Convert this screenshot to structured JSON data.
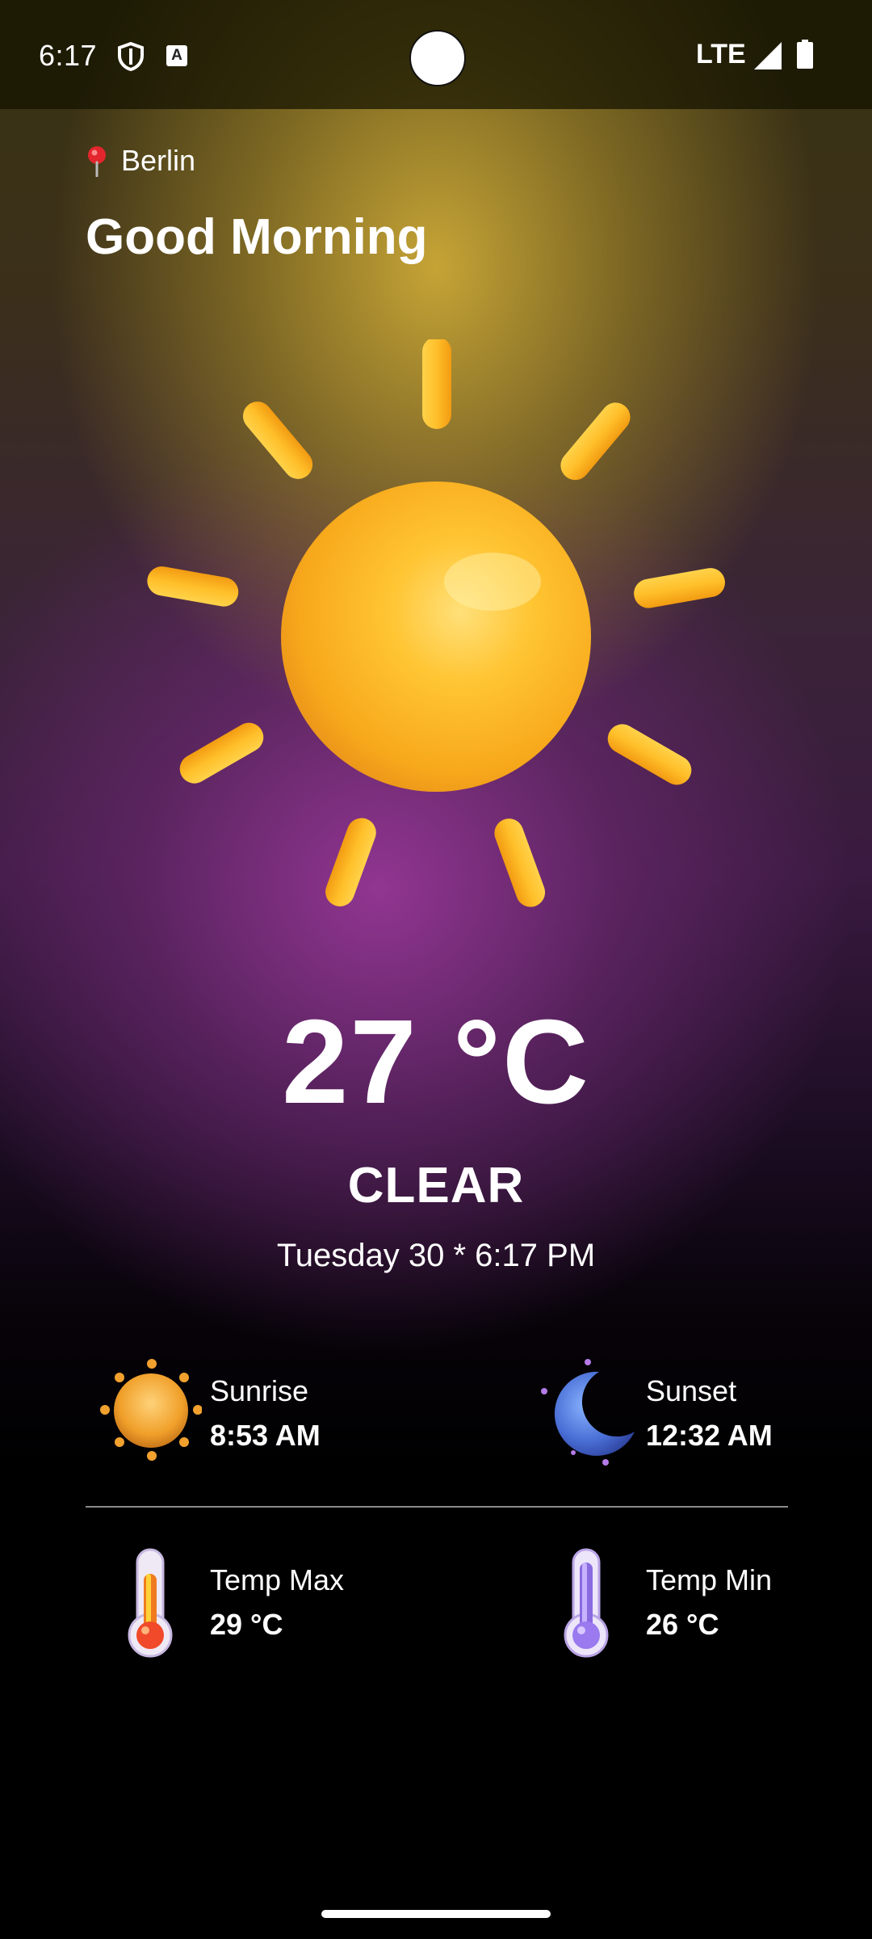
{
  "status_bar": {
    "time": "6:17",
    "network": "LTE"
  },
  "header": {
    "location": "Berlin",
    "greeting": "Good Morning"
  },
  "weather": {
    "icon": "sun-icon",
    "temperature": "27 °C",
    "condition": "CLEAR",
    "datetime": "Tuesday 30 * 6:17 PM"
  },
  "stats": {
    "sunrise": {
      "label": "Sunrise",
      "value": "8:53 AM",
      "icon": "sunrise-icon"
    },
    "sunset": {
      "label": "Sunset",
      "value": "12:32 AM",
      "icon": "moon-icon"
    },
    "temp_max": {
      "label": "Temp Max",
      "value": "29 °C",
      "icon": "thermometer-hot-icon"
    },
    "temp_min": {
      "label": "Temp Min",
      "value": "26 °C",
      "icon": "thermometer-cold-icon"
    }
  },
  "colors": {
    "sun": "#f7b21c",
    "accent_purple": "#8a3592",
    "text": "#ffffff"
  }
}
